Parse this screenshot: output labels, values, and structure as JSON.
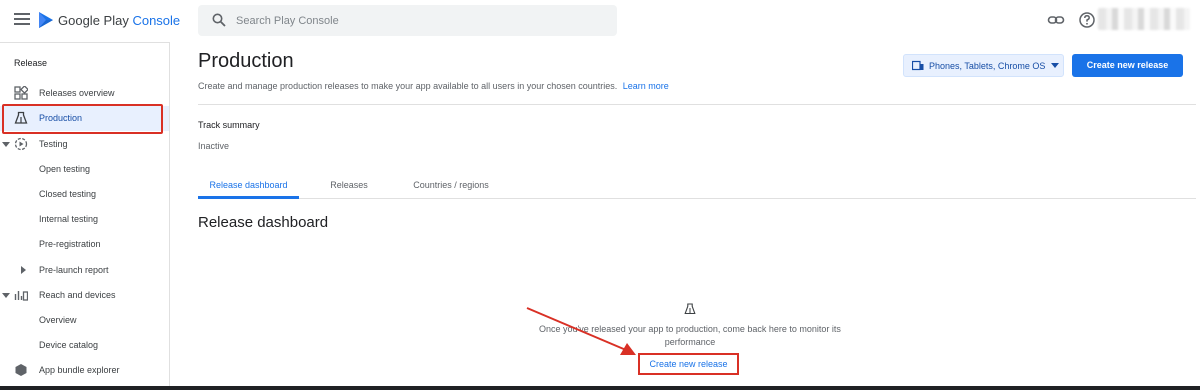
{
  "topbar": {
    "brand_primary": "Google Play",
    "brand_secondary": "Console",
    "search_placeholder": "Search Play Console",
    "icons": [
      "menu-icon",
      "play-console-logo",
      "search-icon",
      "link-icon",
      "help-icon"
    ]
  },
  "sidebar": {
    "section": "Release",
    "items": [
      {
        "label": "Releases overview",
        "icon": "dashboard-icon"
      },
      {
        "label": "Production",
        "icon": "production-icon",
        "active": true
      },
      {
        "label": "Testing",
        "icon": "testing-icon",
        "expanded": true
      },
      {
        "label": "Open testing"
      },
      {
        "label": "Closed testing"
      },
      {
        "label": "Internal testing"
      },
      {
        "label": "Pre-registration"
      },
      {
        "label": "Pre-launch report",
        "collapsed": true
      },
      {
        "label": "Reach and devices",
        "icon": "reach-icon",
        "expanded": true
      },
      {
        "label": "Overview"
      },
      {
        "label": "Device catalog"
      },
      {
        "label": "App bundle explorer",
        "icon": "bundle-icon"
      }
    ]
  },
  "main": {
    "title": "Production",
    "description": "Create and manage production releases to make your app available to all users in your chosen countries.",
    "learn_more": "Learn more",
    "device_select": "Phones, Tablets, Chrome OS",
    "create_button": "Create new release",
    "track_summary_label": "Track summary",
    "track_status": "Inactive",
    "tabs": [
      {
        "label": "Release dashboard",
        "active": true
      },
      {
        "label": "Releases"
      },
      {
        "label": "Countries / regions"
      }
    ],
    "section_title": "Release dashboard",
    "empty_state_line1": "Once you've released your app to production, come back here to monitor its",
    "empty_state_line2": "performance",
    "empty_state_link": "Create new release"
  },
  "colors": {
    "accent": "#1a73e8",
    "highlight": "#d93025",
    "active_bg": "#e8f0fe"
  }
}
